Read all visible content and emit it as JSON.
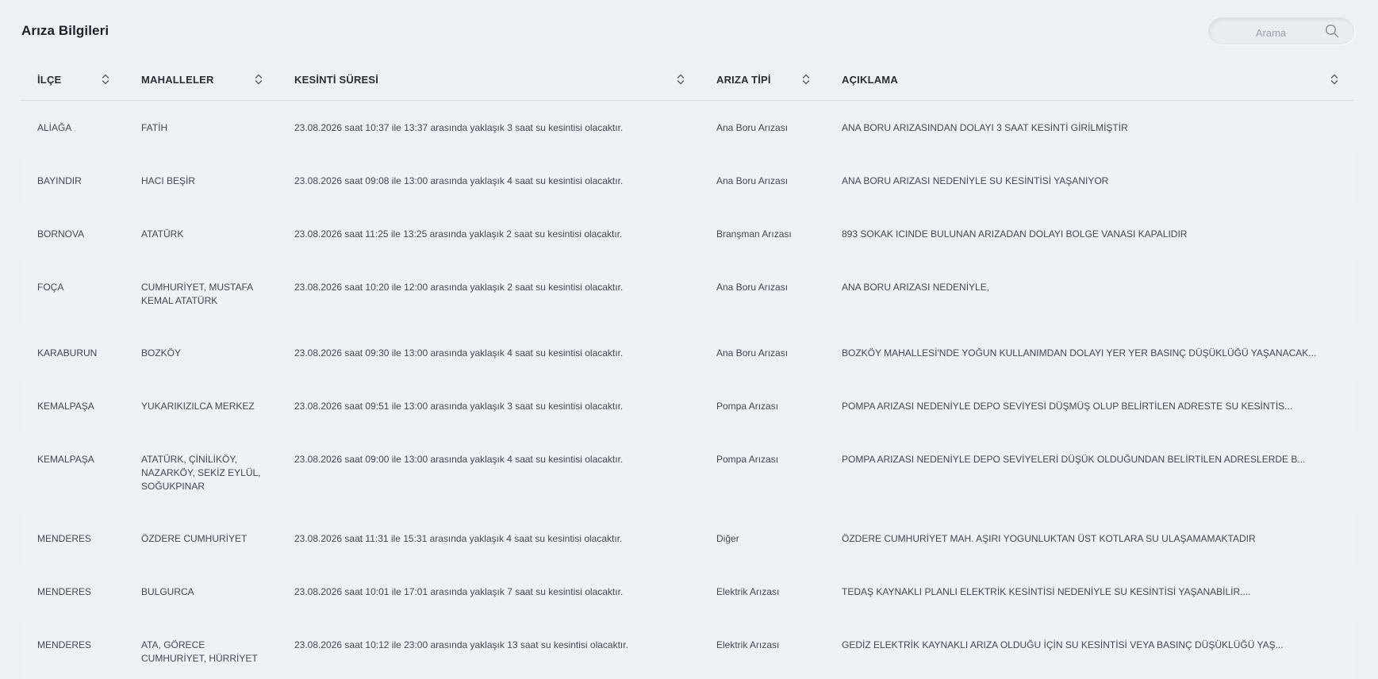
{
  "page": {
    "title": "Arıza Bilgileri"
  },
  "search": {
    "placeholder": "Arama"
  },
  "table": {
    "columns": [
      {
        "key": "ilce",
        "label": "İLÇE"
      },
      {
        "key": "mahalleler",
        "label": "MAHALLELER"
      },
      {
        "key": "kesinti",
        "label": "KESİNTİ SÜRESİ"
      },
      {
        "key": "tip",
        "label": "ARIZA TİPİ"
      },
      {
        "key": "aciklama",
        "label": "AÇIKLAMA"
      }
    ],
    "rows": [
      {
        "ilce": "ALİAĞA",
        "mahalleler": "FATİH",
        "kesinti": "23.08.2026 saat 10:37 ile 13:37 arasında yaklaşık 3 saat su kesintisi olacaktır.",
        "tip": "Ana Boru Arızası",
        "aciklama": "ANA BORU ARIZASINDAN DOLAYI 3 SAAT KESİNTİ GİRİLMİŞTİR"
      },
      {
        "ilce": "BAYINDIR",
        "mahalleler": "HACI BEŞİR",
        "kesinti": "23.08.2026 saat 09:08 ile 13:00 arasında yaklaşık 4 saat su kesintisi olacaktır.",
        "tip": "Ana Boru Arızası",
        "aciklama": "ANA BORU ARIZASI NEDENİYLE SU KESİNTİSİ YAŞANIYOR"
      },
      {
        "ilce": "BORNOVA",
        "mahalleler": "ATATÜRK",
        "kesinti": "23.08.2026 saat 11:25 ile 13:25 arasında yaklaşık 2 saat su kesintisi olacaktır.",
        "tip": "Branşman Arızası",
        "aciklama": "893 SOKAK ICINDE BULUNAN ARIZADAN DOLAYI BOLGE VANASI KAPALIDIR"
      },
      {
        "ilce": "FOÇA",
        "mahalleler": "CUMHURİYET, MUSTAFA KEMAL ATATÜRK",
        "kesinti": "23.08.2026 saat 10:20 ile 12:00 arasında yaklaşık 2 saat su kesintisi olacaktır.",
        "tip": "Ana Boru Arızası",
        "aciklama": "ANA BORU ARIZASI NEDENİYLE,"
      },
      {
        "ilce": "KARABURUN",
        "mahalleler": "BOZKÖY",
        "kesinti": "23.08.2026 saat 09:30 ile 13:00 arasında yaklaşık 4 saat su kesintisi olacaktır.",
        "tip": "Ana Boru Arızası",
        "aciklama": "BOZKÖY MAHALLESİ'NDE YOĞUN KULLANIMDAN DOLAYI YER YER BASINÇ DÜŞÜKLÜĞÜ YAŞANACAK..."
      },
      {
        "ilce": "KEMALPAŞA",
        "mahalleler": "YUKARIKIZILCA MERKEZ",
        "kesinti": "23.08.2026 saat 09:51 ile 13:00 arasında yaklaşık 3 saat su kesintisi olacaktır.",
        "tip": "Pompa Arızası",
        "aciklama": "POMPA ARIZASI NEDENİYLE DEPO SEVİYESİ DÜŞMÜŞ OLUP BELİRTİLEN ADRESTE SU KESİNTİS..."
      },
      {
        "ilce": "KEMALPAŞA",
        "mahalleler": "ATATÜRK, ÇİNİLİKÖY, NAZARKÖY, SEKİZ EYLÜL, SOĞUKPINAR",
        "kesinti": "23.08.2026 saat 09:00 ile 13:00 arasında yaklaşık 4 saat su kesintisi olacaktır.",
        "tip": "Pompa Arızası",
        "aciklama": "POMPA ARIZASI NEDENİYLE DEPO SEVİYELERİ DÜŞÜK OLDUĞUNDAN BELİRTİLEN ADRESLERDE B..."
      },
      {
        "ilce": "MENDERES",
        "mahalleler": "ÖZDERE CUMHURİYET",
        "kesinti": "23.08.2026 saat 11:31 ile 15:31 arasında yaklaşık 4 saat su kesintisi olacaktır.",
        "tip": "Diğer",
        "aciklama": "ÖZDERE CUMHURİYET MAH. AŞIRI YOGUNLUKTAN ÜST KOTLARA SU ULAŞAMAMAKTADIR"
      },
      {
        "ilce": "MENDERES",
        "mahalleler": "BULGURCA",
        "kesinti": "23.08.2026 saat 10:01 ile 17:01 arasında yaklaşık 7 saat su kesintisi olacaktır.",
        "tip": "Elektrik Arızası",
        "aciklama": "TEDAŞ KAYNAKLI PLANLI ELEKTRİK KESİNTİSİ NEDENİYLE SU KESİNTİSİ YAŞANABİLİR...."
      },
      {
        "ilce": "MENDERES",
        "mahalleler": "ATA, GÖRECE CUMHURİYET, HÜRRİYET",
        "kesinti": "23.08.2026 saat 10:12 ile 23:00 arasında yaklaşık 13 saat su kesintisi olacaktır.",
        "tip": "Elektrik Arızası",
        "aciklama": "GEDİZ ELEKTRİK KAYNAKLI ARIZA OLDUĞU İÇİN SU KESİNTİSİ VEYA BASINÇ DÜŞÜKLÜĞÜ YAŞ..."
      }
    ]
  }
}
